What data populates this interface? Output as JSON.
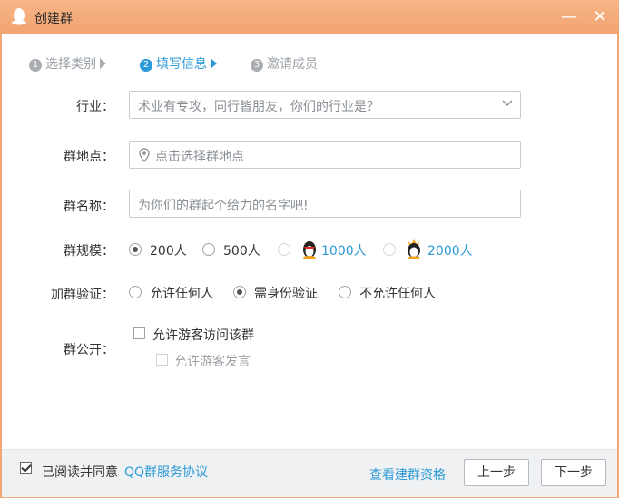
{
  "window": {
    "title": "创建群",
    "minimize_glyph": "—",
    "close_glyph": "✕"
  },
  "steps": [
    {
      "num": "1",
      "label": "选择类别",
      "state": "done"
    },
    {
      "num": "2",
      "label": "填写信息",
      "state": "active"
    },
    {
      "num": "3",
      "label": "邀请成员",
      "state": "pending"
    }
  ],
  "form": {
    "industry": {
      "label": "行业：",
      "placeholder": "术业有专攻，同行皆朋友，你们的行业是？"
    },
    "location": {
      "label": "群地点：",
      "placeholder": "点击选择群地点"
    },
    "name": {
      "label": "群名称：",
      "placeholder": "为你们的群起个给力的名字吧!"
    },
    "size": {
      "label": "群规模：",
      "options": [
        "200人",
        "500人",
        "1000人",
        "2000人"
      ],
      "selected": "200人"
    },
    "verify": {
      "label": "加群验证：",
      "options": [
        "允许任何人",
        "需身份验证",
        "不允许任何人"
      ],
      "selected": "需身份验证"
    },
    "public": {
      "label": "群公开：",
      "allow_guest_visit": "允许游客访问该群",
      "allow_guest_speak": "允许游客发言"
    }
  },
  "footer": {
    "agree_text": "已阅读并同意",
    "agreement_link": "QQ群服务协议",
    "qualify_link": "查看建群资格",
    "prev_button": "上一步",
    "next_button": "下一步"
  },
  "colors": {
    "titlebar": "#f2a874",
    "accent": "#2b9ad6"
  }
}
